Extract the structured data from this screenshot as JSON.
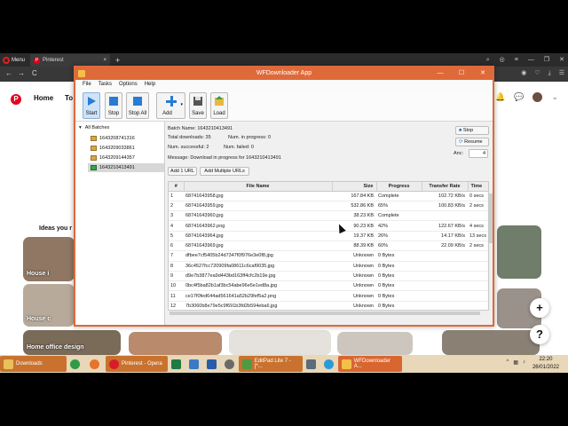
{
  "browser": {
    "menu_label": "Menu",
    "tab_title": "Pinterest",
    "tab_close": "×",
    "new_tab": "+",
    "nav": {
      "back": "←",
      "forward": "→",
      "reload": "C"
    }
  },
  "pinterest": {
    "logo": "P",
    "home": "Home",
    "today_partial": "To",
    "ideas_heading": "Ideas you r",
    "cards": [
      {
        "label": "House i"
      },
      {
        "label": "House c"
      },
      {
        "label": "Home office design"
      }
    ],
    "fab_plus": "+",
    "fab_help": "?"
  },
  "app": {
    "title": "WFDownloader App",
    "window_controls": {
      "minimize": "—",
      "maximize": "☐",
      "close": "✕"
    },
    "menu": [
      "File",
      "Tasks",
      "Options",
      "Help"
    ],
    "toolbar": {
      "start": "Start",
      "stop": "Stop",
      "stop_all": "Stop All",
      "add": "Add",
      "save": "Save",
      "load": "Load"
    },
    "tree": {
      "root": "All Batches",
      "items": [
        "1643208741316",
        "1643209033861",
        "1643209144357",
        "1643210413491"
      ]
    },
    "info": {
      "batch_name_label": "Batch Name:",
      "batch_name": "1643210413491",
      "total_downloads_label": "Total downloads:",
      "total_downloads": "35",
      "in_progress_label": "Num. in progress:",
      "in_progress": "0",
      "successful_label": "Num. successful:",
      "successful": "2",
      "failed_label": "Num. failed:",
      "failed": "0",
      "message_label": "Message:",
      "message": "Download in progress for 1643210413491"
    },
    "buttons": {
      "stop": "Stop",
      "resume": "Resume",
      "anc_label": "Anc:",
      "anc_value": "4",
      "add_one_url": "Add 1 URL",
      "add_multiple_urls": "Add Multiple URLs"
    },
    "columns": [
      "#",
      "File Name",
      "Size",
      "Progress",
      "Transfer Rate",
      "Time"
    ],
    "rows": [
      [
        "1",
        "68741643958.jpg",
        "167.84 KB",
        "Complete",
        "102.72 KB/s",
        "0 secs"
      ],
      [
        "2",
        "68741643959.jpg",
        "532.86 KB",
        "65%",
        "100.83 KB/s",
        "2 secs"
      ],
      [
        "3",
        "68741643960.jpg",
        "38.23 KB",
        "Complete",
        "",
        ""
      ],
      [
        "4",
        "68741643962.png",
        "90.23 KB",
        "42%",
        "122.67 KB/s",
        "4 secs"
      ],
      [
        "5",
        "68741643964.jpg",
        "19.37 KB",
        "26%",
        "14.17 KB/s",
        "13 secs"
      ],
      [
        "6",
        "68741643969.jpg",
        "88.39 KB",
        "60%",
        "22.09 KB/s",
        "2 secs"
      ],
      [
        "7",
        "dfbee7cf5405b24d7347f0f976e3e0f8.jpg",
        "Unknown",
        "0 Bytes",
        "",
        ""
      ],
      [
        "8",
        "36c4527fcc720909fa08611c6caf9035.jpg",
        "Unknown",
        "0 Bytes",
        "",
        ""
      ],
      [
        "9",
        "d9e7b3877ea9d443bd163ff4cfc2b19e.jpg",
        "Unknown",
        "0 Bytes",
        "",
        ""
      ],
      [
        "10",
        "0bc4f5ba82b1af3bc54abe96e5e1ed8a.jpg",
        "Unknown",
        "0 Bytes",
        "",
        ""
      ],
      [
        "11",
        "ce17f0fed644ad561641a52b29fef5a2.png",
        "Unknown",
        "0 Bytes",
        "",
        ""
      ],
      [
        "12",
        "7b3060b8e79e5c9f691b3fd2b594eba6.jpg",
        "Unknown",
        "0 Bytes",
        "",
        ""
      ]
    ]
  },
  "taskbar": {
    "items": [
      "Downloads",
      "Pinterest - Opera",
      "EditPad Lite 7 - [*...",
      "WFDownloader A..."
    ],
    "time": "22:20",
    "date": "26/01/2022"
  },
  "colors": {
    "window_accent": "#de6a3a",
    "pinterest_red": "#e60023",
    "taskbar": "#e8d7b8"
  }
}
